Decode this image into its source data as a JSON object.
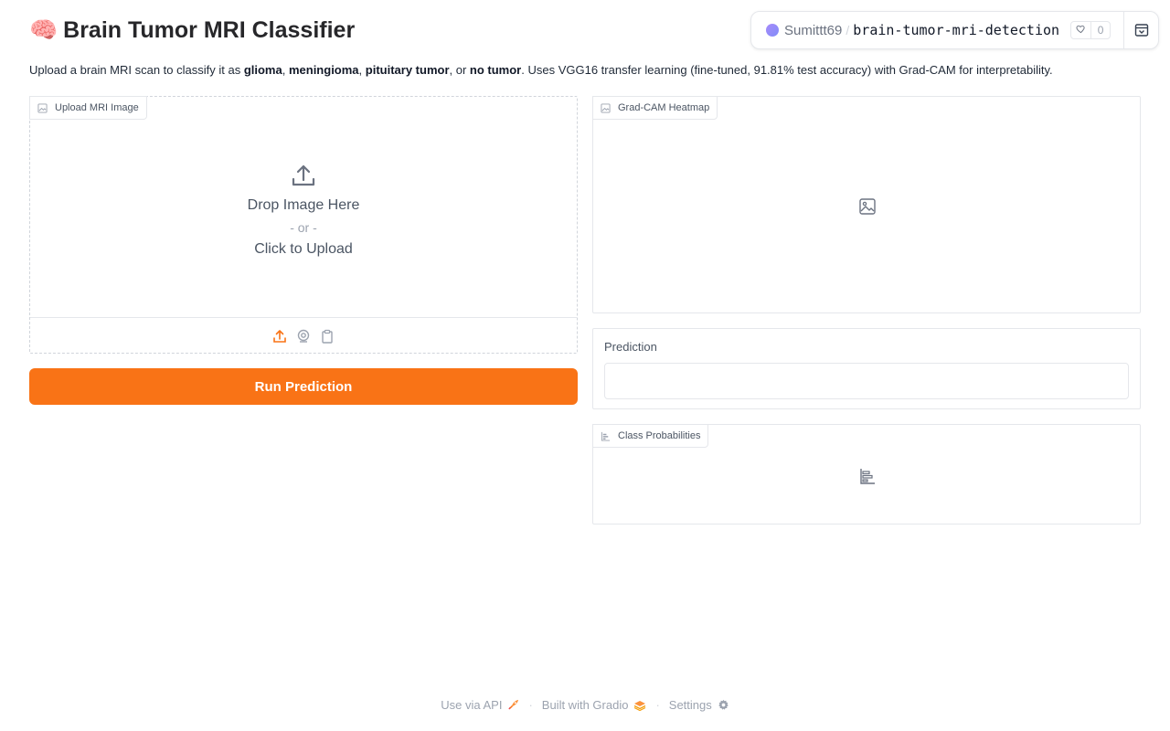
{
  "header": {
    "emoji": "🧠",
    "title": "Brain Tumor MRI Classifier"
  },
  "space_badge": {
    "owner": "Sumittt69",
    "separator": "/",
    "repo": "brain-tumor-mri-detection",
    "likes": "0"
  },
  "description": {
    "pre": "Upload a brain MRI scan to classify it as ",
    "c1": "glioma",
    "s1": ", ",
    "c2": "meningioma",
    "s2": ", ",
    "c3": "pituitary tumor",
    "s3": ", or ",
    "c4": "no tumor",
    "post": ". Uses VGG16 transfer learning (fine-tuned, 91.81% test accuracy) with Grad-CAM for interpretability."
  },
  "upload": {
    "label": "Upload MRI Image",
    "drop_text": "Drop Image Here",
    "or_text": "- or -",
    "click_text": "Click to Upload"
  },
  "run_button": "Run Prediction",
  "gradcam": {
    "label": "Grad-CAM Heatmap"
  },
  "prediction": {
    "label": "Prediction",
    "value": ""
  },
  "probabilities": {
    "label": "Class Probabilities"
  },
  "footer": {
    "api": "Use via API",
    "built": "Built with Gradio",
    "settings": "Settings",
    "dot": "·"
  },
  "colors": {
    "accent": "#f97316",
    "border": "#e5e7eb"
  }
}
